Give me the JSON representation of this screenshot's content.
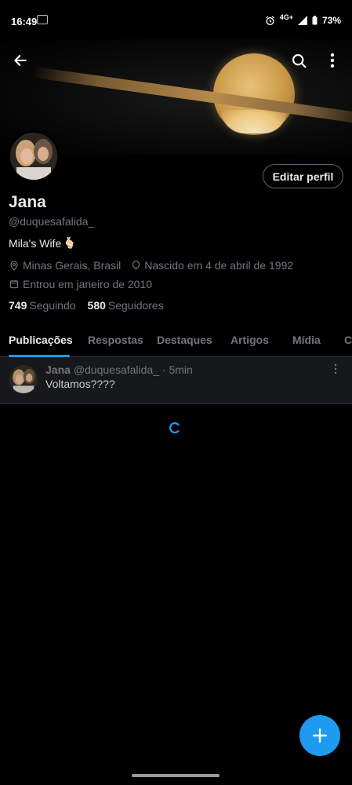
{
  "status_bar": {
    "time": "16:49",
    "network": "4G+",
    "battery": "73%"
  },
  "profile": {
    "name": "Jana",
    "handle": "@duquesafalida_",
    "bio": "Mila's Wife",
    "bio_emoji": "🫰🏻",
    "location": "Minas Gerais, Brasil",
    "birthday": "Nascido em 4 de abril de 1992",
    "joined": "Entrou em janeiro de 2010",
    "following_count": "749",
    "following_label": "Seguindo",
    "followers_count": "580",
    "followers_label": "Seguidores",
    "edit_label": "Editar perfil"
  },
  "tabs": [
    {
      "label": "Publicações",
      "active": true
    },
    {
      "label": "Respostas",
      "active": false
    },
    {
      "label": "Destaques",
      "active": false
    },
    {
      "label": "Artigos",
      "active": false
    },
    {
      "label": "Mídia",
      "active": false
    },
    {
      "label": "C",
      "active": false
    }
  ],
  "post": {
    "author": "Jana",
    "handle": "@duquesafalida_",
    "separator": "·",
    "time": "5min",
    "text": "Voltamos????"
  },
  "colors": {
    "accent": "#1d9bf0",
    "background": "#000000",
    "muted": "#71767b",
    "text": "#e7e9ea"
  },
  "icons": {
    "back": "arrow-left-icon",
    "search": "search-icon",
    "more": "more-vertical-icon",
    "location": "location-pin-icon",
    "birthday": "balloon-icon",
    "calendar": "calendar-icon",
    "compose": "plus-icon"
  }
}
